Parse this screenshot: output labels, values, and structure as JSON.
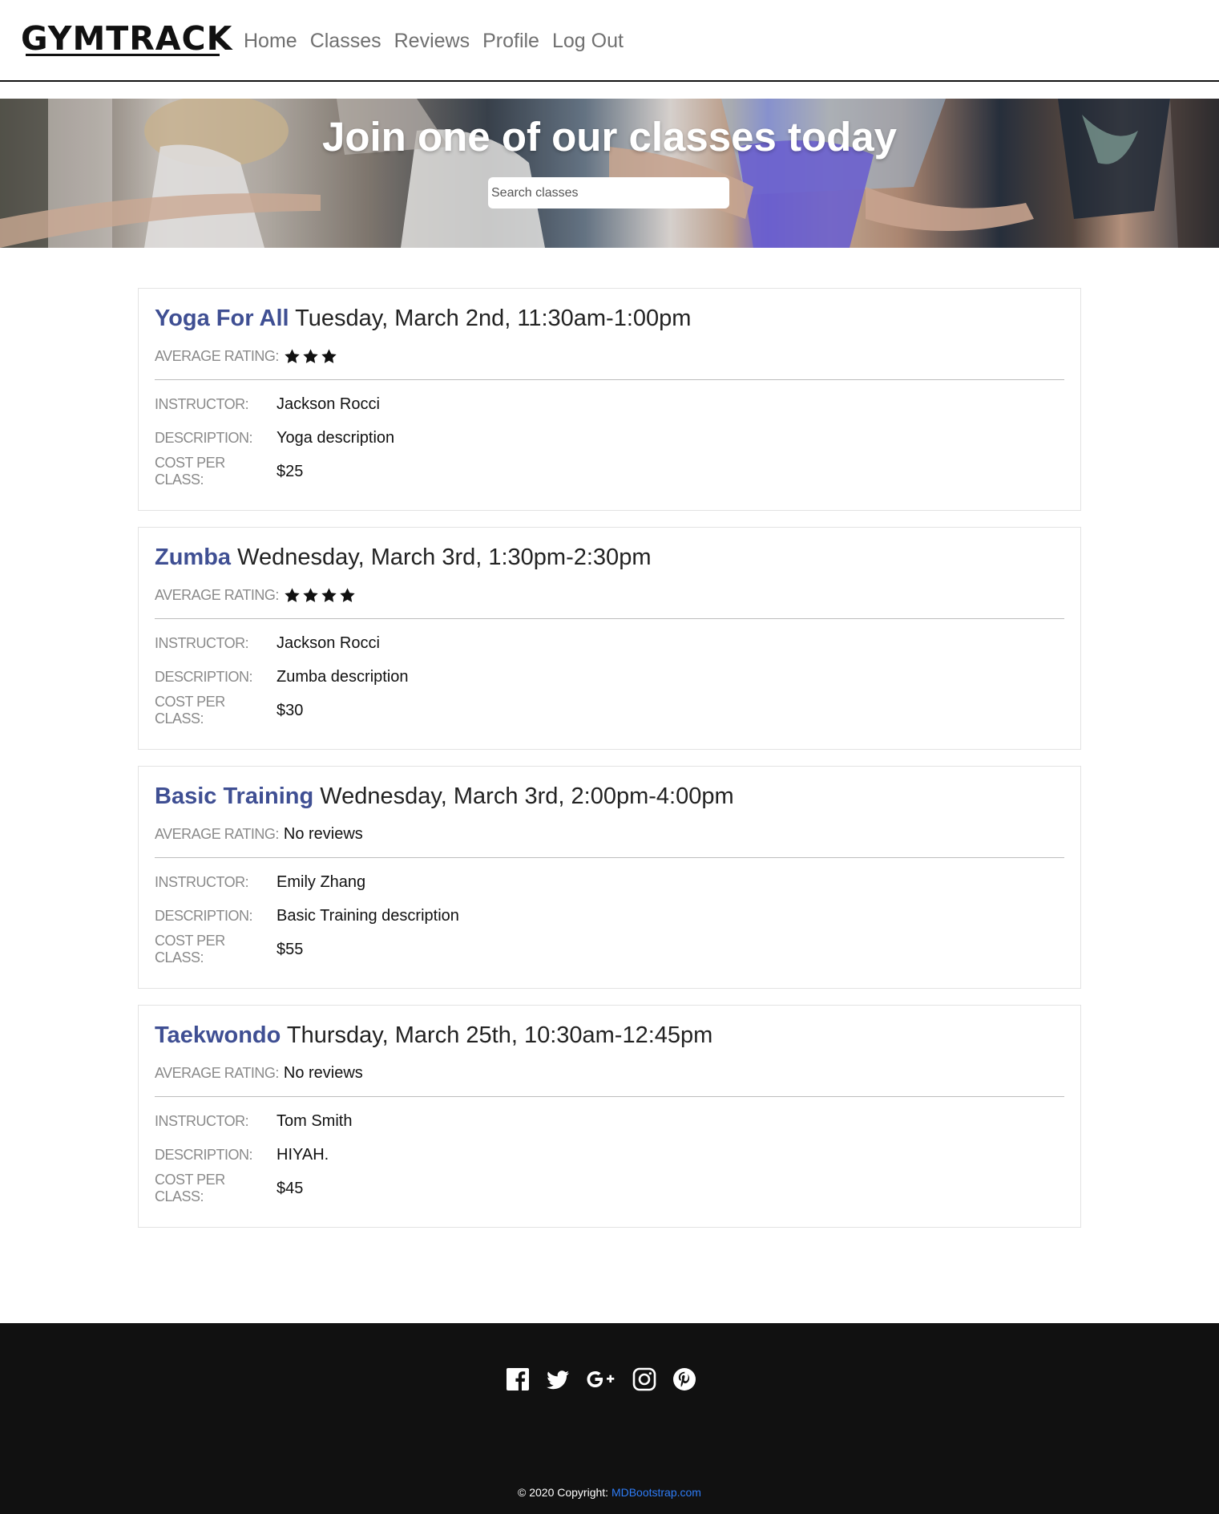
{
  "nav": {
    "brand": "GYMTRACK",
    "links": [
      "Home",
      "Classes",
      "Reviews",
      "Profile",
      "Log Out"
    ]
  },
  "hero": {
    "title": "Join one of our classes today",
    "search_placeholder": "Search classes"
  },
  "labels": {
    "average_rating": "AVERAGE RATING:",
    "instructor": "INSTRUCTOR:",
    "description": "DESCRIPTION:",
    "cost": "COST PER CLASS:"
  },
  "classes": [
    {
      "name": "Yoga For All",
      "time": "Tuesday, March 2nd, 11:30am-1:00pm",
      "rating_stars": 3,
      "rating_text": "",
      "instructor": "Jackson Rocci",
      "description": "Yoga description",
      "cost": "$25"
    },
    {
      "name": "Zumba",
      "time": "Wednesday, March 3rd, 1:30pm-2:30pm",
      "rating_stars": 4,
      "rating_text": "",
      "instructor": "Jackson Rocci",
      "description": "Zumba description",
      "cost": "$30"
    },
    {
      "name": "Basic Training",
      "time": "Wednesday, March 3rd, 2:00pm-4:00pm",
      "rating_stars": 0,
      "rating_text": "No reviews",
      "instructor": "Emily Zhang",
      "description": "Basic Training description",
      "cost": "$55"
    },
    {
      "name": "Taekwondo",
      "time": "Thursday, March 25th, 10:30am-12:45pm",
      "rating_stars": 0,
      "rating_text": "No reviews",
      "instructor": "Tom Smith",
      "description": "HIYAH.",
      "cost": "$45"
    }
  ],
  "footer": {
    "social_icons": [
      "facebook-icon",
      "twitter-icon",
      "google-plus-icon",
      "instagram-icon",
      "pinterest-icon"
    ],
    "copyright_text": "© 2020 Copyright: ",
    "copyright_link": "MDBootstrap.com"
  },
  "colors": {
    "class_name": "#3f4f93",
    "footer_bg": "#111111",
    "link_blue": "#2e7cf6"
  }
}
